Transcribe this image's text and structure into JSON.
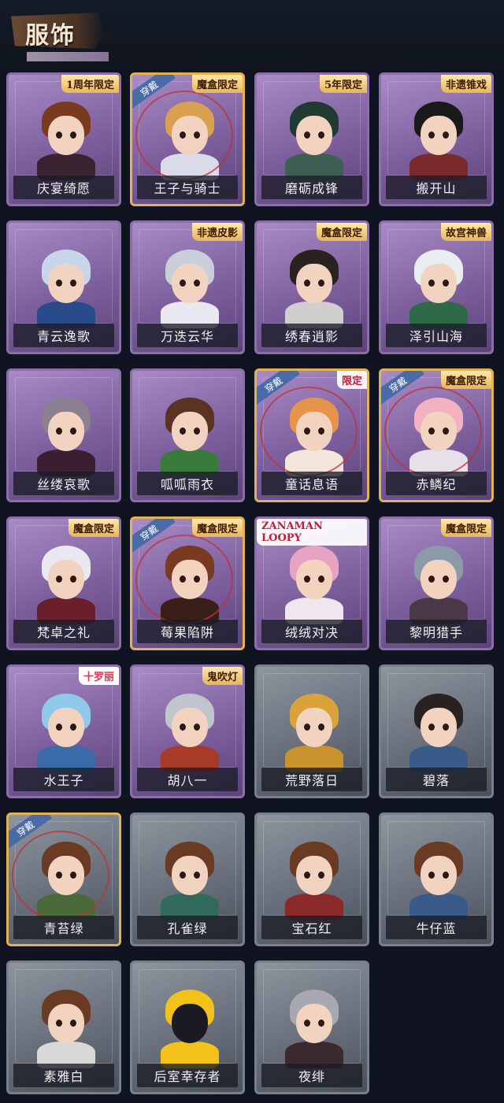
{
  "header": {
    "title": "服饰"
  },
  "labels": {
    "worn": "穿戴"
  },
  "costumes": [
    {
      "name": "庆宴绮愿",
      "badge": "1周年限定",
      "theme": "purple",
      "hair": "#7a3a1e",
      "cloth": "#3b2231"
    },
    {
      "name": "王子与骑士",
      "badge": "魔盒限定",
      "theme": "purple",
      "worn": true,
      "hair": "#d9a050",
      "cloth": "#d9dce8"
    },
    {
      "name": "磨砺成锋",
      "badge": "5年限定",
      "theme": "purple",
      "hair": "#1f3b32",
      "cloth": "#3e5f52"
    },
    {
      "name": "搬开山",
      "badge": "非遗锥戏",
      "theme": "purple",
      "hair": "#1a1a1a",
      "cloth": "#7a2a2a"
    },
    {
      "name": "青云逸歌",
      "badge": "",
      "theme": "purple",
      "hair": "#c8d6ea",
      "cloth": "#2a4b8a"
    },
    {
      "name": "万迭云华",
      "badge": "非遗皮影",
      "theme": "purple",
      "hair": "#c9cfd8",
      "cloth": "#e8e8f0"
    },
    {
      "name": "绣春逍影",
      "badge": "魔盒限定",
      "theme": "purple",
      "hair": "#2a221e",
      "cloth": "#cfcfcf"
    },
    {
      "name": "泽引山海",
      "badge": "故宫神兽",
      "theme": "purple",
      "hair": "#e8eef0",
      "cloth": "#2f6a48"
    },
    {
      "name": "丝缕哀歌",
      "badge": "",
      "theme": "purple",
      "hair": "#8a8090",
      "cloth": "#3a1f33"
    },
    {
      "name": "呱呱雨衣",
      "badge": "",
      "theme": "purple",
      "hair": "#5a3322",
      "cloth": "#3a7a3a"
    },
    {
      "name": "童话息语",
      "badge": "限定",
      "theme": "purple",
      "worn": true,
      "hair": "#e8934a",
      "cloth": "#f2e6da"
    },
    {
      "name": "赤鳞纪",
      "badge": "魔盒限定",
      "theme": "purple",
      "worn": true,
      "hair": "#f2b2c0",
      "cloth": "#e8e0e8"
    },
    {
      "name": "梵卓之礼",
      "badge": "魔盒限定",
      "theme": "purple",
      "hair": "#e8e8ee",
      "cloth": "#6a1f2a"
    },
    {
      "name": "莓果陷阱",
      "badge": "魔盒限定",
      "theme": "purple",
      "worn": true,
      "hair": "#7a3a20",
      "cloth": "#3a1e18"
    },
    {
      "name": "绒绒对决",
      "badge": "ZANAMAN LOOPY",
      "theme": "purple",
      "hair": "#e8a2c2",
      "cloth": "#f0e6ee"
    },
    {
      "name": "黎明猎手",
      "badge": "魔盒限定",
      "theme": "purple",
      "hair": "#8a9aa8",
      "cloth": "#4a3a48"
    },
    {
      "name": "水王子",
      "badge": "十罗丽",
      "theme": "purple",
      "hair": "#8ec8ea",
      "cloth": "#3a6aa8"
    },
    {
      "name": "胡八一",
      "badge": "鬼吹灯",
      "theme": "purple",
      "hair": "#c0c4cc",
      "cloth": "#a83a2a"
    },
    {
      "name": "荒野落日",
      "badge": "",
      "theme": "gray",
      "hair": "#d9a23a",
      "cloth": "#c9922e"
    },
    {
      "name": "碧落",
      "badge": "",
      "theme": "gray",
      "hair": "#2a2220",
      "cloth": "#3a5a8a"
    },
    {
      "name": "青苔绿",
      "badge": "",
      "theme": "gray",
      "worn": true,
      "hair": "#6a3a22",
      "cloth": "#4a6a3a"
    },
    {
      "name": "孔雀绿",
      "badge": "",
      "theme": "gray",
      "hair": "#6a3a22",
      "cloth": "#2f6a5a"
    },
    {
      "name": "宝石红",
      "badge": "",
      "theme": "gray",
      "hair": "#6a3a22",
      "cloth": "#8a2a2a"
    },
    {
      "name": "牛仔蓝",
      "badge": "",
      "theme": "gray",
      "hair": "#6a3a22",
      "cloth": "#3a5a8a"
    },
    {
      "name": "素雅白",
      "badge": "",
      "theme": "gray",
      "hair": "#6a3a22",
      "cloth": "#d8d8d8"
    },
    {
      "name": "后室幸存者",
      "badge": "",
      "theme": "gray",
      "hair": "#f2c21a",
      "cloth": "#f2c21a"
    },
    {
      "name": "夜绯",
      "badge": "",
      "theme": "gray",
      "hair": "#a8a8b0",
      "cloth": "#3a2a2e"
    }
  ]
}
